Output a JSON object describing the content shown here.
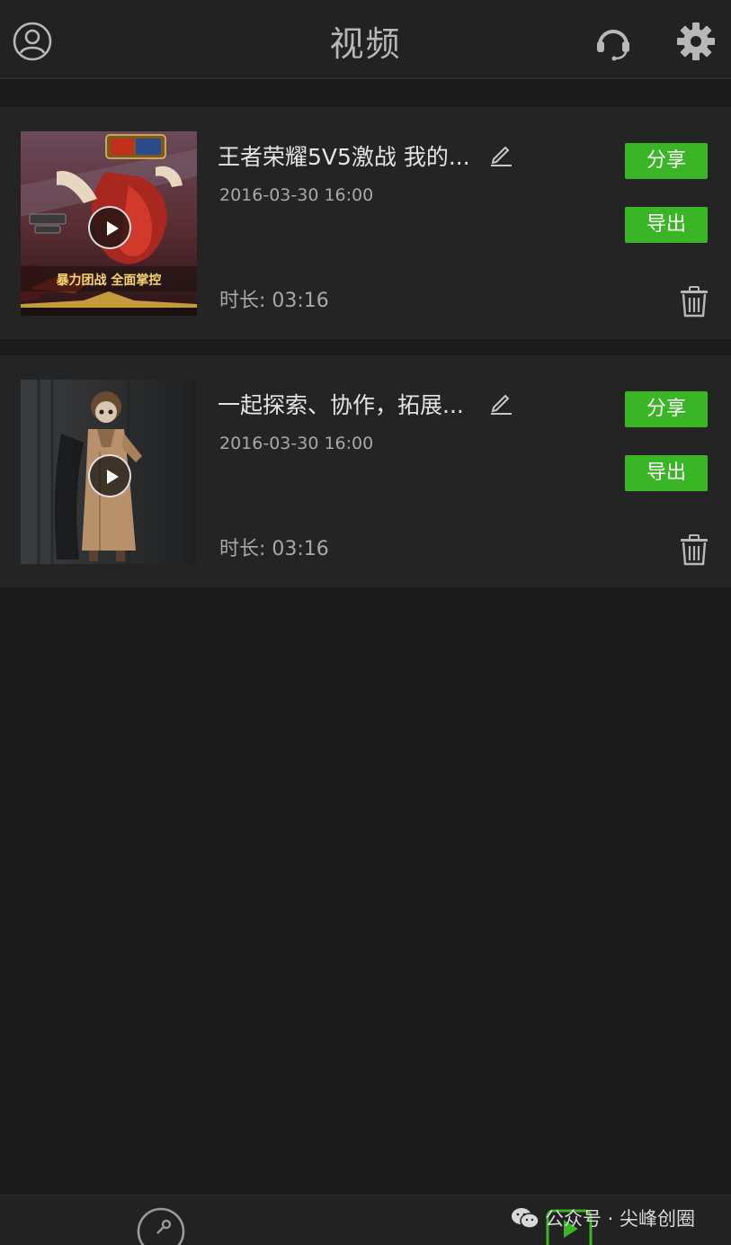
{
  "header": {
    "title": "视频"
  },
  "videos": [
    {
      "title": "王者荣耀5V5激战 我的...",
      "date": "2016-03-30  16:00",
      "duration": "时长: 03:16",
      "share_label": "分享",
      "export_label": "导出",
      "thumb_caption": "暴力团战 全面掌控"
    },
    {
      "title": "一起探索、协作，拓展...",
      "date": "2016-03-30  16:00",
      "duration": "时长: 03:16",
      "share_label": "分享",
      "export_label": "导出"
    }
  ],
  "watermark": {
    "text": "公众号 · 尖峰创圈"
  },
  "colors": {
    "accent_green": "#3ab526",
    "background": "#1b1b1b",
    "card": "#242424"
  }
}
